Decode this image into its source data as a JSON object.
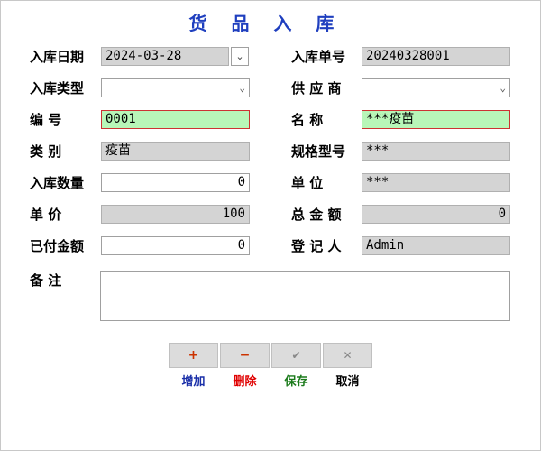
{
  "title": "货 品 入 库",
  "labels": {
    "in_date": "入库日期",
    "in_no": "入库单号",
    "in_type": "入库类型",
    "supplier": "供 应 商",
    "code": "编    号",
    "name": "名    称",
    "category": "类    别",
    "spec": "规格型号",
    "qty": "入库数量",
    "unit": "单    位",
    "price": "单    价",
    "total": "总 金 额",
    "paid": "已付金额",
    "registrar": "登 记 人",
    "memo": "备    注"
  },
  "values": {
    "in_date": "2024-03-28",
    "in_no": "20240328001",
    "in_type": "",
    "supplier": "",
    "code": "0001",
    "name": "***疫苗",
    "category": "疫苗",
    "spec": "***",
    "qty": "0",
    "unit": "***",
    "price": "100",
    "total": "0",
    "paid": "0",
    "registrar": "Admin",
    "memo": ""
  },
  "toolbar": {
    "add": {
      "icon": "+",
      "label": "增加",
      "color": "#1a2fa8",
      "icon_color": "#cc3300"
    },
    "delete": {
      "icon": "−",
      "label": "删除",
      "color": "#e00000",
      "icon_color": "#cc3300"
    },
    "save": {
      "icon": "✔",
      "label": "保存",
      "color": "#1a7a1a",
      "icon_color": "#888888"
    },
    "cancel": {
      "icon": "✕",
      "label": "取消",
      "color": "#000000",
      "icon_color": "#888888"
    }
  },
  "icons": {
    "dropdown": "chevron-down-icon",
    "date_spin": "spin-icon"
  }
}
